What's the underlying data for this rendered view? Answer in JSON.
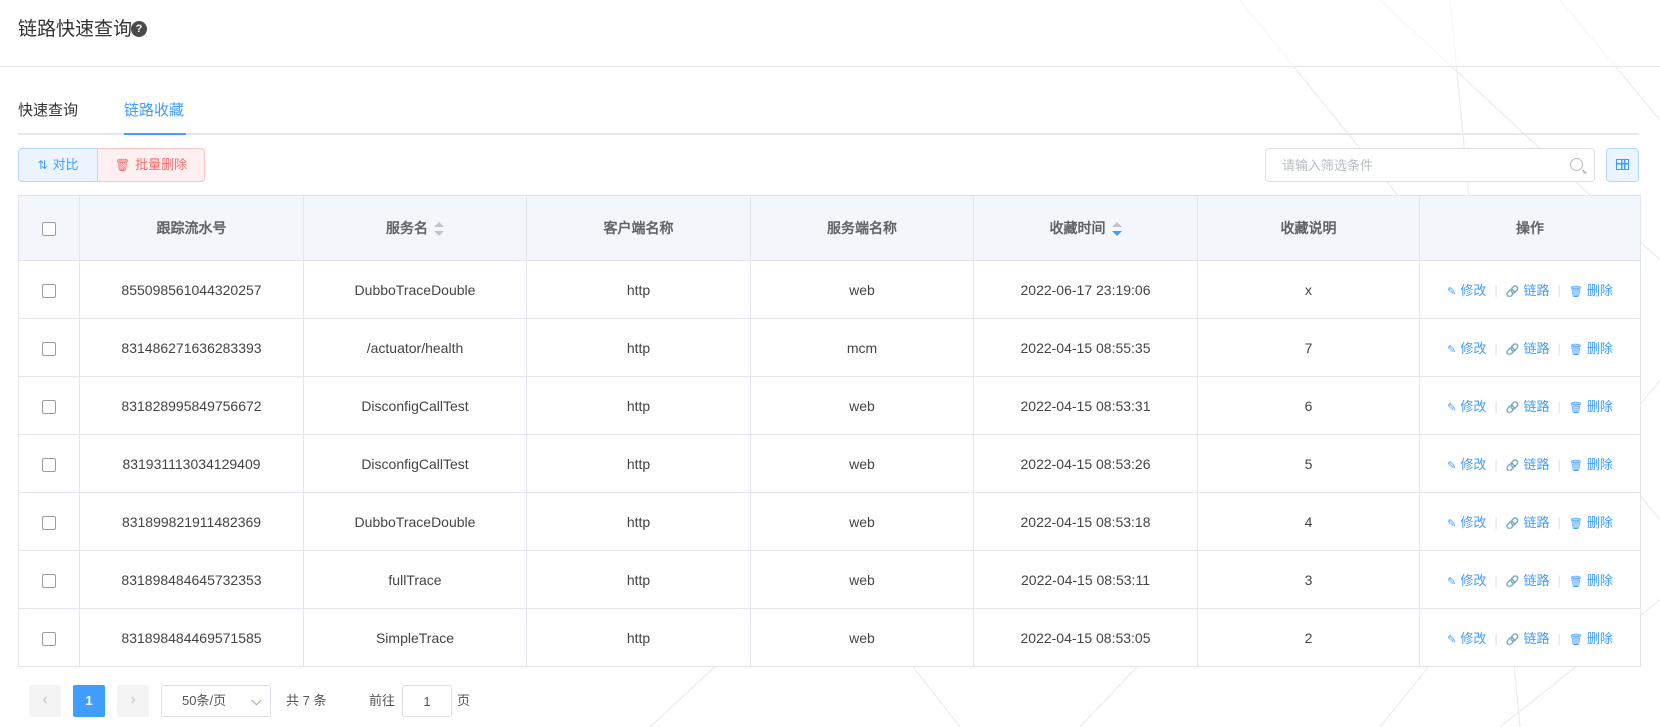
{
  "header": {
    "title": "链路快速查询",
    "help_icon": "question-circle-icon"
  },
  "tabs": [
    {
      "label": "快速查询",
      "active": false
    },
    {
      "label": "链路收藏",
      "active": true
    }
  ],
  "toolbar": {
    "compare_label": "对比",
    "batch_delete_label": "批量删除",
    "grid_icon": "table-grid-icon"
  },
  "search": {
    "placeholder": "请输入筛选条件",
    "value": ""
  },
  "table": {
    "columns": [
      "跟踪流水号",
      "服务名",
      "客户端名称",
      "服务端名称",
      "收藏时间",
      "收藏说明",
      "操作"
    ],
    "sort": {
      "服务名": "none",
      "收藏时间": "desc"
    },
    "actions": {
      "edit": "修改",
      "trace": "链路",
      "delete": "删除"
    },
    "rows": [
      [
        "855098561044320257",
        "DubboTraceDouble",
        "http",
        "web",
        "2022-06-17 23:19:06",
        "x"
      ],
      [
        "831486271636283393",
        "/actuator/health",
        "http",
        "mcm",
        "2022-04-15 08:55:35",
        "7"
      ],
      [
        "831828995849756672",
        "DisconfigCallTest",
        "http",
        "web",
        "2022-04-15 08:53:31",
        "6"
      ],
      [
        "831931113034129409",
        "DisconfigCallTest",
        "http",
        "web",
        "2022-04-15 08:53:26",
        "5"
      ],
      [
        "831899821911482369",
        "DubboTraceDouble",
        "http",
        "web",
        "2022-04-15 08:53:18",
        "4"
      ],
      [
        "831898484645732353",
        "fullTrace",
        "http",
        "web",
        "2022-04-15 08:53:11",
        "3"
      ],
      [
        "831898484469571585",
        "SimpleTrace",
        "http",
        "web",
        "2022-04-15 08:53:05",
        "2"
      ]
    ]
  },
  "pagination": {
    "current_page": "1",
    "page_size": "50条/页",
    "total": "共 7 条",
    "goto_label": "前往",
    "goto_value": "1",
    "page_unit": "页"
  },
  "colors": {
    "accent": "#409eff",
    "danger": "#f56c6c",
    "header_bg": "#f3f6fa",
    "border": "#e3e6ec"
  }
}
